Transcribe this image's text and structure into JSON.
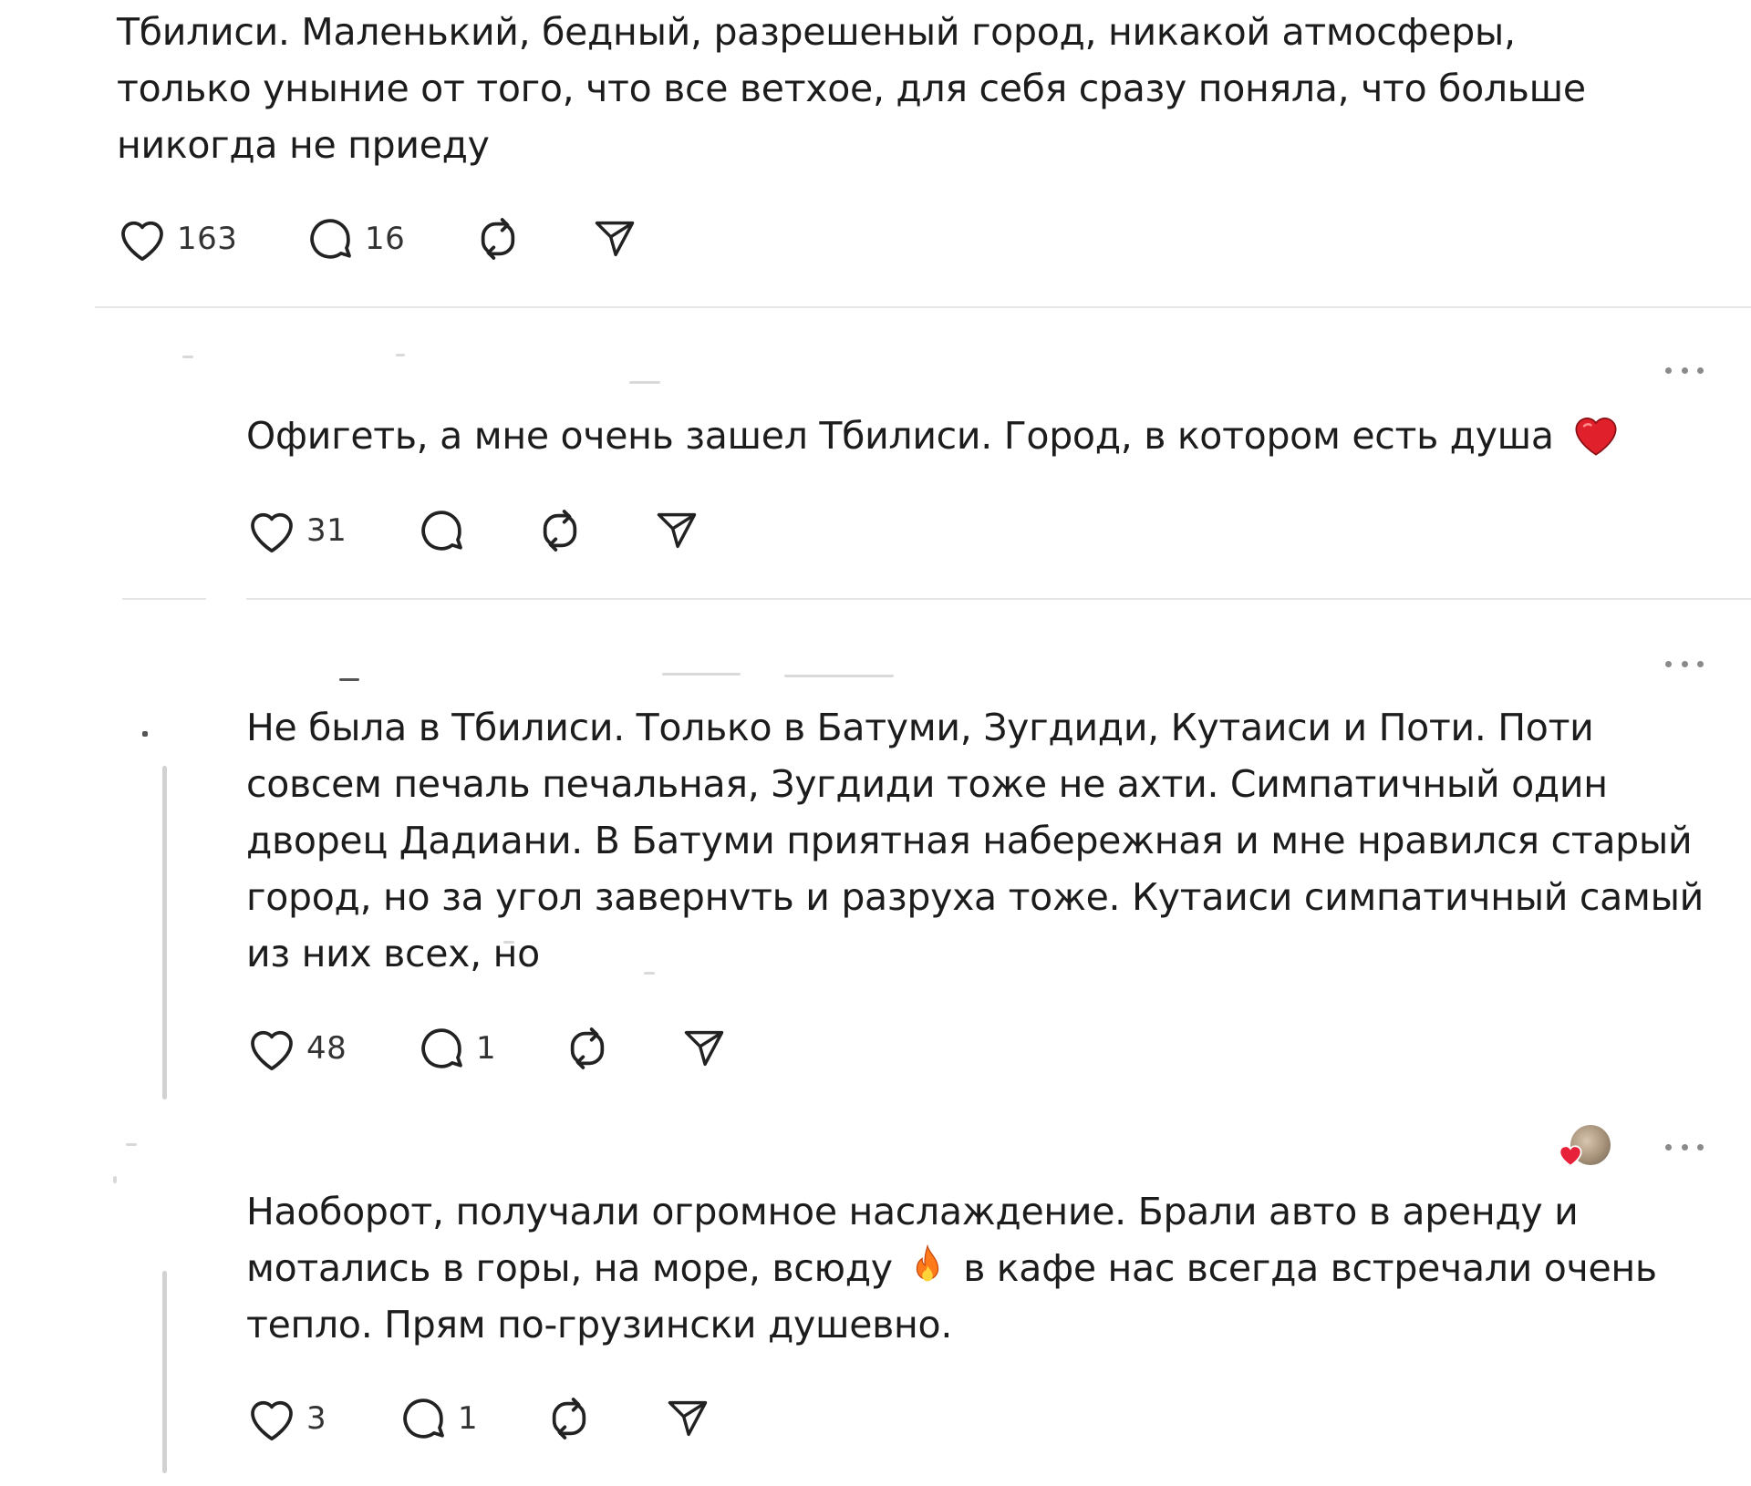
{
  "posts": [
    {
      "text": "Тбилиси. Маленький, бедный, разрешеный город, никакой атмосферы, только уныние от того, что все ветхое, для себя сразу поняла, что больше никогда не приеду",
      "likes": "163",
      "replies": "16"
    },
    {
      "text": "Офигеть, а мне очень зашел Тбилиси. Город, в котором есть душа",
      "emoji": "red-heart",
      "likes": "31",
      "replies": ""
    },
    {
      "text": "Не была в Тбилиси. Только в Батуми, Зугдиди, Кутаиси и Поти. Поти совсем печаль печальная, Зугдиди тоже не ахти. Симпатичный один дворец Дадиани. В Батуми приятная набережная и мне нравился старый город, но за угол завернvть и разруха тоже. Кутаиси симпатичный самый из них всех, но",
      "likes": "48",
      "replies": "1"
    },
    {
      "text_before_emoji": "Наоборот, получали огромное наслаждение. Брали авто в аренду и мотались в горы, на море, всюду",
      "emoji": "fire",
      "text_after_emoji": "в кафе нас всегда встречали очень тепло. Прям по-грузински душевно.",
      "likes": "3",
      "replies": "1"
    }
  ],
  "colors": {
    "text": "#1c1c1c",
    "icon": "#222222",
    "divider": "#e6e6e6",
    "thread_line": "#d2d2d2",
    "heart_emoji": "#e0202a"
  }
}
